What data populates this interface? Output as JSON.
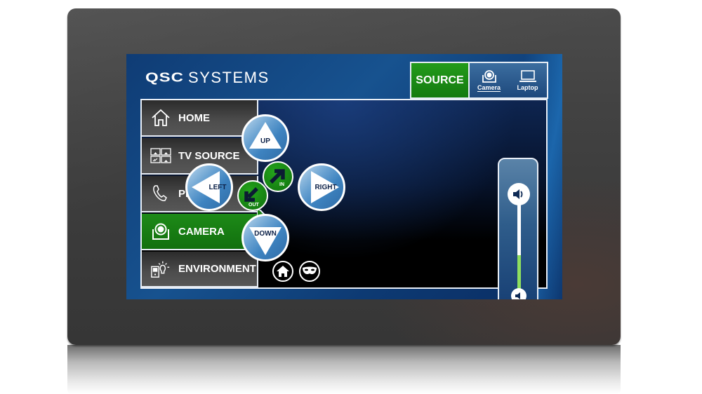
{
  "device": {
    "brand_bold": "QSC",
    "brand_light": "SYSTEMS"
  },
  "source_selector": {
    "label": "SOURCE",
    "options": [
      {
        "label": "Camera",
        "icon": "camera-icon",
        "selected": true
      },
      {
        "label": "Laptop",
        "icon": "laptop-icon",
        "selected": false
      }
    ]
  },
  "nav": {
    "items": [
      {
        "label": "HOME",
        "icon": "house-outline-icon",
        "active": false
      },
      {
        "label": "TV SOURCE",
        "icon": "tv-source-grid-icon",
        "active": false
      },
      {
        "label": "PHONE",
        "icon": "phone-handset-icon",
        "active": false
      },
      {
        "label": "CAMERA",
        "icon": "camera-icon",
        "active": true
      },
      {
        "label": "ENVIRONMENT",
        "icon": "environment-lightbulb-icon",
        "active": false
      }
    ]
  },
  "camera_controls": {
    "up": "UP",
    "down": "DOWN",
    "left": "LEFT",
    "right": "RIGHT",
    "zoom_in": "IN",
    "zoom_out": "OUT"
  },
  "bottom_icons": [
    {
      "icon": "home-preset-icon"
    },
    {
      "icon": "privacy-mask-icon"
    }
  ],
  "volume": {
    "label": "Volume",
    "level_percent": 40
  },
  "colors": {
    "active_green": "#1d8a18",
    "screen_blue": "#17528f",
    "button_blue": "#3e83c0",
    "volume_fill": "#8fdf5f"
  }
}
